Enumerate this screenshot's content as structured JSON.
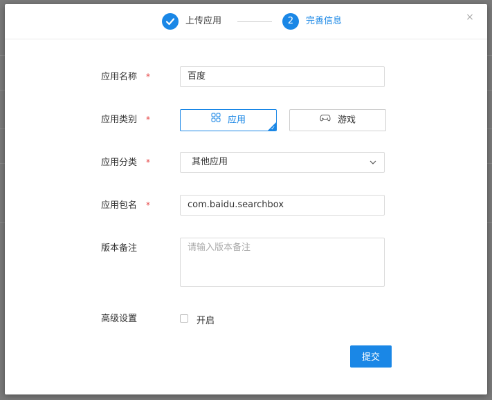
{
  "steps": [
    {
      "index": "✓",
      "label": "上传应用",
      "state": "done"
    },
    {
      "index": "2",
      "label": "完善信息",
      "state": "active"
    }
  ],
  "close_label": "×",
  "form": {
    "app_name": {
      "label": "应用名称",
      "required": "*",
      "value": "百度"
    },
    "app_type": {
      "label": "应用类别",
      "required": "*",
      "options": [
        {
          "label": "应用",
          "icon": "grid-icon",
          "selected": true
        },
        {
          "label": "游戏",
          "icon": "gamepad-icon",
          "selected": false
        }
      ]
    },
    "app_category": {
      "label": "应用分类",
      "required": "*",
      "value": "其他应用"
    },
    "package_name": {
      "label": "应用包名",
      "required": "*",
      "value": "com.baidu.searchbox"
    },
    "version_note": {
      "label": "版本备注",
      "placeholder": "请输入版本备注"
    },
    "advanced": {
      "label": "高级设置",
      "checkbox_label": "开启",
      "checked": false
    }
  },
  "submit_label": "提交",
  "colors": {
    "accent": "#1a87e6",
    "required": "#e64545"
  }
}
